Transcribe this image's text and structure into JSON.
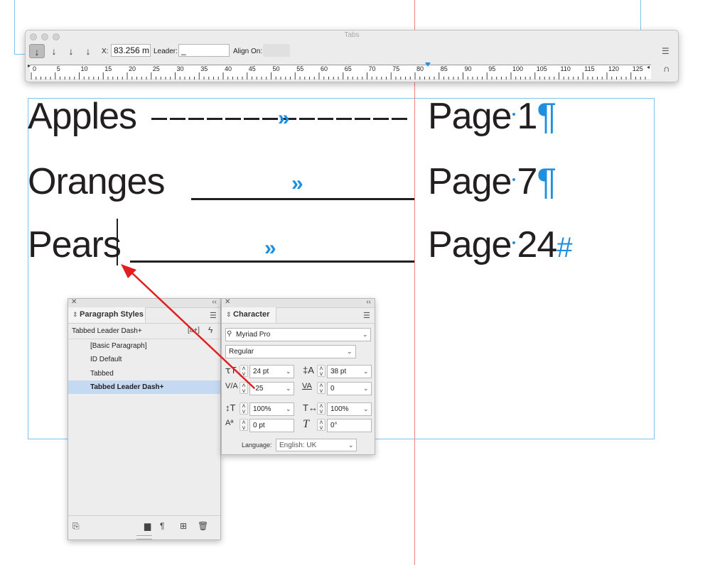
{
  "tabs_panel": {
    "title": "Tabs",
    "x_label": "X:",
    "x_value": "83.256 m",
    "leader_label": "Leader:",
    "leader_value": "_",
    "align_on_label": "Align On:",
    "align_buttons": [
      "left-justified-tab",
      "center-justified-tab",
      "right-justified-tab",
      "align-to-decimal-tab"
    ],
    "ruler_ticks": [
      "0",
      "5",
      "10",
      "15",
      "20",
      "25",
      "30",
      "35",
      "40",
      "45",
      "50",
      "55",
      "60",
      "65",
      "70",
      "75",
      "80",
      "85",
      "90",
      "95",
      "100",
      "105",
      "110",
      "115",
      "120",
      "125"
    ]
  },
  "document": {
    "lines": [
      {
        "left": "Apples",
        "right": "Page",
        "number": "1",
        "end_mark": "¶",
        "leader": "dashes"
      },
      {
        "left": "Oranges",
        "right": "Page",
        "number": "7",
        "end_mark": "¶",
        "leader": "underline"
      },
      {
        "left": "Pears",
        "right": "Page",
        "number": "24",
        "end_mark": "#",
        "leader": "underline"
      }
    ],
    "tab_mark": "»",
    "dash_leader_text": "––––––––––––––"
  },
  "paragraph_styles_panel": {
    "title": "Paragraph Styles",
    "current_style": "Tabbed Leader Dash+",
    "items": [
      "[Basic Paragraph]",
      "ID Default",
      "Tabbed",
      "Tabbed Leader Dash+"
    ],
    "selected_index": 3
  },
  "character_panel": {
    "title": "Character",
    "font_family": "Myriad Pro",
    "font_style": "Regular",
    "font_size": "24 pt",
    "leading": "38 pt",
    "kerning": "-25",
    "tracking": "0",
    "vertical_scale": "100%",
    "horizontal_scale": "100%",
    "baseline_shift": "0 pt",
    "skew": "0°",
    "language_label": "Language:",
    "language_value": "English: UK"
  },
  "colors": {
    "guide_red": "#f08080",
    "frame_blue": "#7fc4ef",
    "hidden_char_blue": "#1f8fe0",
    "arrow_red": "#e02020",
    "selection_blue": "#c5d9f2"
  }
}
